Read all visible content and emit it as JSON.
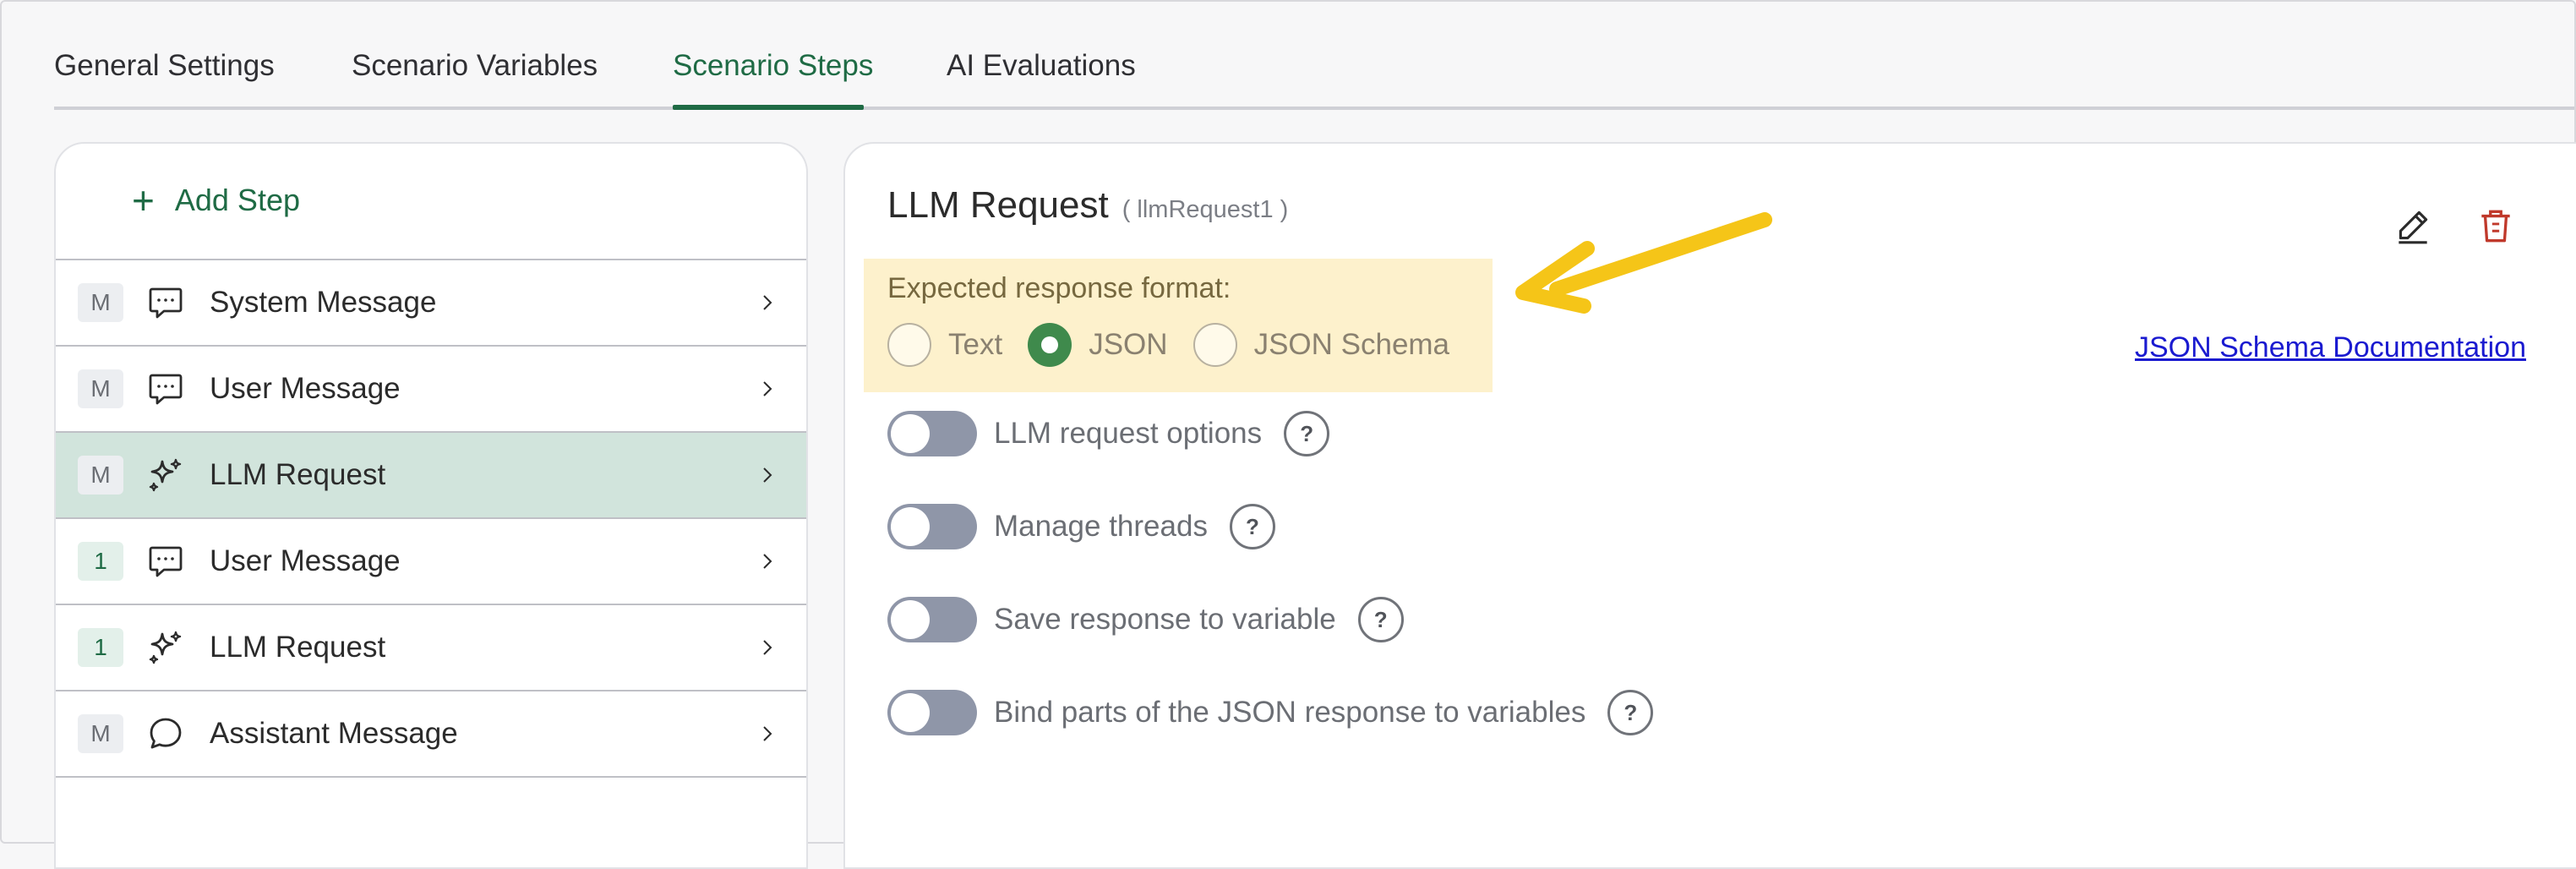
{
  "tabs": [
    {
      "label": "General Settings",
      "active": false
    },
    {
      "label": "Scenario Variables",
      "active": false
    },
    {
      "label": "Scenario Steps",
      "active": true
    },
    {
      "label": "AI Evaluations",
      "active": false
    }
  ],
  "steps_panel": {
    "add_step_label": "Add Step",
    "steps": [
      {
        "badge": "M",
        "icon": "chat-bubble-icon",
        "label": "System Message",
        "selected": false
      },
      {
        "badge": "M",
        "icon": "chat-bubble-icon",
        "label": "User Message",
        "selected": false
      },
      {
        "badge": "M",
        "icon": "sparkles-icon",
        "label": "LLM Request",
        "selected": true
      },
      {
        "badge": "1",
        "icon": "chat-bubble-icon",
        "label": "User Message",
        "selected": false
      },
      {
        "badge": "1",
        "icon": "sparkles-icon",
        "label": "LLM Request",
        "selected": false
      },
      {
        "badge": "M",
        "icon": "speech-bubble-icon",
        "label": "Assistant Message",
        "selected": false
      }
    ]
  },
  "detail": {
    "title": "LLM Request",
    "subtitle": "( llmRequest1 )",
    "response_format": {
      "label": "Expected response format:",
      "options": [
        "Text",
        "JSON",
        "JSON Schema"
      ],
      "selected": "JSON"
    },
    "doc_link": "JSON Schema Documentation",
    "toggles": [
      {
        "label": "LLM request options",
        "on": false
      },
      {
        "label": "Manage threads",
        "on": false
      },
      {
        "label": "Save response to variable",
        "on": false
      },
      {
        "label": "Bind parts of the JSON response to variables",
        "on": false
      }
    ],
    "help_glyph": "?"
  },
  "colors": {
    "accent": "#1f6b45",
    "selected_row": "#d1e4dc",
    "highlight": "#fdf1cc",
    "radio_checked": "#3f8a4c",
    "toggle_off": "#8f96a8",
    "delete": "#c0392b",
    "link": "#1a1ad0",
    "annotation_arrow": "#f5c518"
  }
}
